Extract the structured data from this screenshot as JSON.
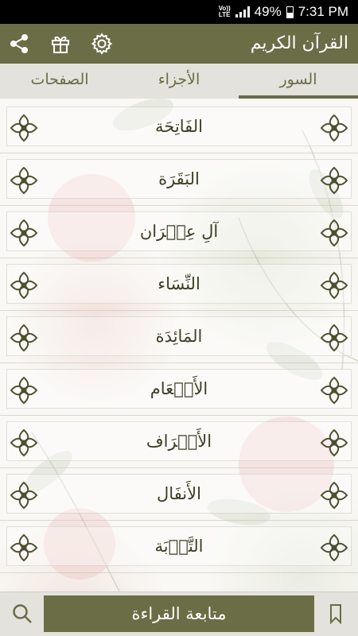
{
  "status_bar": {
    "volte": "Vo)) LTE",
    "battery": "49%",
    "time": "7:31 PM"
  },
  "app_bar": {
    "title": "القرآن الكريم",
    "icons": [
      "share-icon",
      "gift-icon",
      "gear-icon"
    ]
  },
  "tabs": [
    {
      "label": "الصفحات",
      "active": false
    },
    {
      "label": "الأجزاء",
      "active": false
    },
    {
      "label": "السور",
      "active": true
    }
  ],
  "surahs": [
    {
      "name": "الفَاتِحَة"
    },
    {
      "name": "البَقَرَة"
    },
    {
      "name": "آلِ عِمۡرَان"
    },
    {
      "name": "النِّسَاء"
    },
    {
      "name": "المَائِدَة"
    },
    {
      "name": "الأَنۡعَام"
    },
    {
      "name": "الأَعۡرَاف"
    },
    {
      "name": "الأَنفَال"
    },
    {
      "name": "التَّوۡبَة"
    }
  ],
  "bottom_bar": {
    "continue_label": "متابعة القراءة",
    "icons": [
      "search-icon",
      "bookmark-icon"
    ]
  },
  "colors": {
    "accent": "#6a6d46",
    "tab_bg": "#e3e2dc",
    "text": "#3d3f26"
  }
}
